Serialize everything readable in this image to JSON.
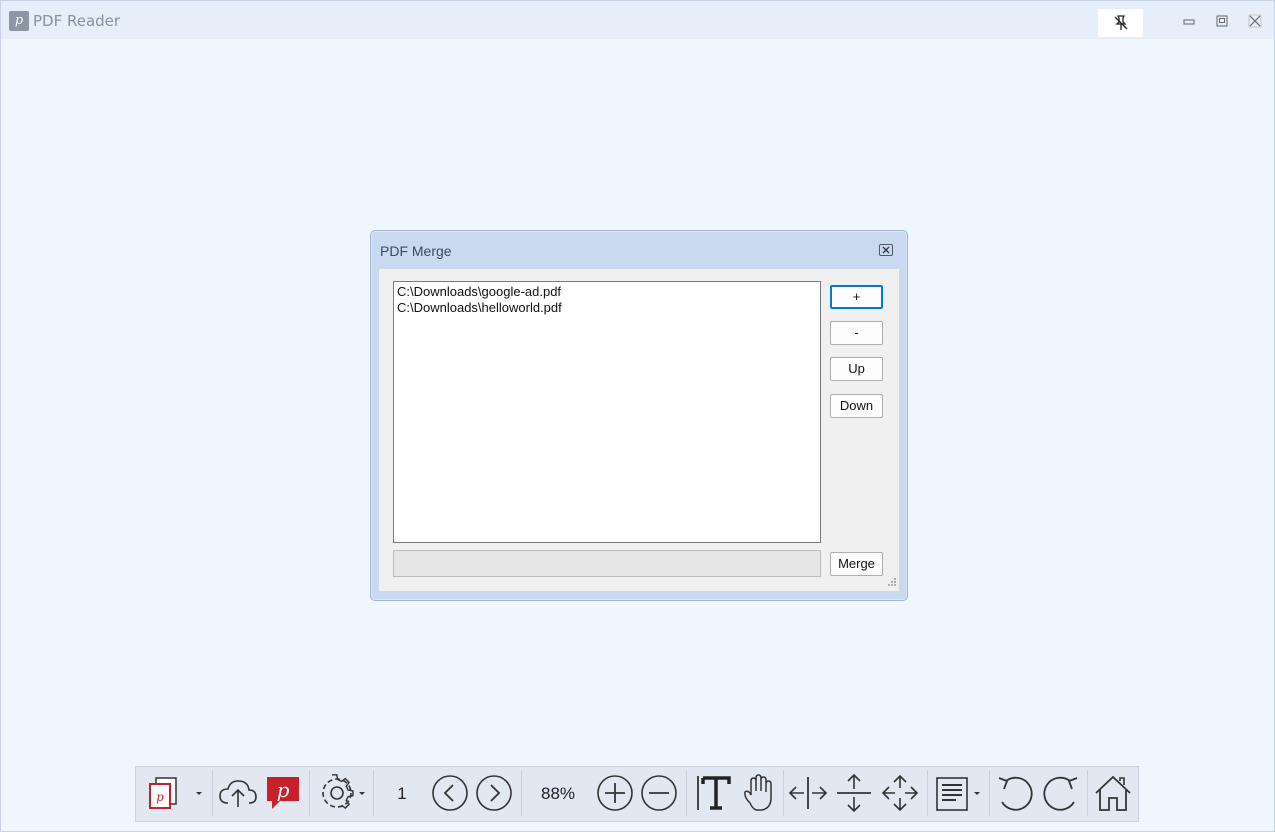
{
  "window": {
    "title": "PDF Reader",
    "app_icon_glyph": "p"
  },
  "dialog": {
    "title": "PDF Merge",
    "files": [
      "C:\\Downloads\\google-ad.pdf",
      "C:\\Downloads\\helloworld.pdf"
    ],
    "buttons": {
      "add": "+",
      "remove": "-",
      "up": "Up",
      "down": "Down",
      "merge": "Merge"
    }
  },
  "toolbar": {
    "page_number": "1",
    "zoom": "88%",
    "icons": [
      "open-pdf-icon",
      "dropdown-arrow-icon",
      "cloud-upload-icon",
      "pdf-reader-logo-icon",
      "settings-gear-icon",
      "previous-page-icon",
      "next-page-icon",
      "zoom-in-icon",
      "zoom-out-icon",
      "text-select-icon",
      "hand-pan-icon",
      "fit-width-icon",
      "fit-height-icon",
      "fit-page-icon",
      "page-layout-icon",
      "rotate-left-icon",
      "rotate-right-icon",
      "home-icon"
    ]
  },
  "colors": {
    "accent": "#0078d7",
    "brand_red": "#c8202a",
    "dialog_frame": "#c9d9ef"
  }
}
